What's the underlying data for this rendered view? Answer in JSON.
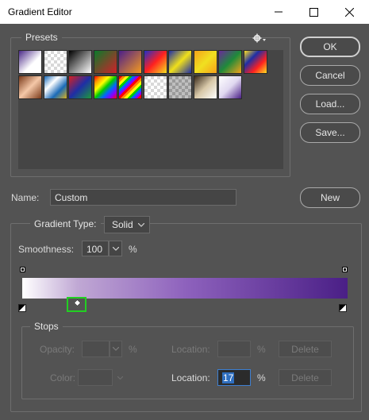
{
  "window": {
    "title": "Gradient Editor"
  },
  "presets": {
    "label": "Presets",
    "menu_icon": "gear-icon",
    "swatches": [
      "linear-gradient(135deg,#4b2a88 0%,#ffffff 60%)",
      "repeating-conic-gradient(#ffffff 0 25%,#d8d8d8 0 50%) 0 0/8px 8px",
      "linear-gradient(135deg,#000000,#ffffff)",
      "linear-gradient(135deg,#0a7a2a,#d2202a)",
      "linear-gradient(135deg,#4b1f8a,#f59a1f)",
      "linear-gradient(135deg,#2030c8,#ff2020,#f2e020)",
      "linear-gradient(135deg,#1e2ea6,#f0e01a,#1e2ea6)",
      "linear-gradient(135deg,#f5a21a,#f0e020,#f5a21a)",
      "linear-gradient(135deg,#6a2a9a,#1e8a3a,#f5a21a)",
      "linear-gradient(135deg,#ffe020,#1e2ea6,#ff2020,#ffe020)",
      "linear-gradient(135deg,#7a3a1a,#f5c8a8,#7a3a1a)",
      "linear-gradient(135deg,#1a6ab8,#ffffff,#1a6ab8,#d8b020)",
      "linear-gradient(135deg,#d82020,#1e2ea6,#1e9a3a)",
      "linear-gradient(135deg,#ff0000,#ff9900,#ffff00,#00cc00,#0066ff,#8800ff,#ff0000)",
      "repeating-linear-gradient(135deg,#ff0000 0 3px,#ff8800 3px 6px,#ffff00 6px 9px,#00cc00 9px 12px,#0066ff 12px 15px,#8800ff 15px 18px)",
      "repeating-conic-gradient(#ffffff 0 25%,#d8d8d8 0 50%) 0 0/8px 8px",
      "repeating-conic-gradient(#bfbfbf 0 25%,#9a9a9a 0 50%) 0 0/8px 8px",
      "linear-gradient(135deg,#3a2a1a,#d8c8a8,#ffffff)",
      "linear-gradient(135deg,#ffffff,#e0d8f0,#4a1f86)"
    ]
  },
  "buttons": {
    "ok": "OK",
    "cancel": "Cancel",
    "load": "Load...",
    "save": "Save...",
    "new": "New"
  },
  "name_row": {
    "label": "Name:",
    "value": "Custom"
  },
  "gradient_type": {
    "label": "Gradient Type:",
    "value": "Solid"
  },
  "smoothness": {
    "label": "Smoothness:",
    "value": "100",
    "unit": "%"
  },
  "stops": {
    "label": "Stops",
    "opacity_label": "Opacity:",
    "opacity_value": "",
    "opacity_unit": "%",
    "opacity_location_label": "Location:",
    "opacity_location_value": "",
    "opacity_location_unit": "%",
    "opacity_delete": "Delete",
    "color_label": "Color:",
    "color_location_label": "Location:",
    "color_location_value": "17",
    "color_location_unit": "%",
    "color_delete": "Delete"
  },
  "gradient": {
    "selected_stop_location": 17
  }
}
